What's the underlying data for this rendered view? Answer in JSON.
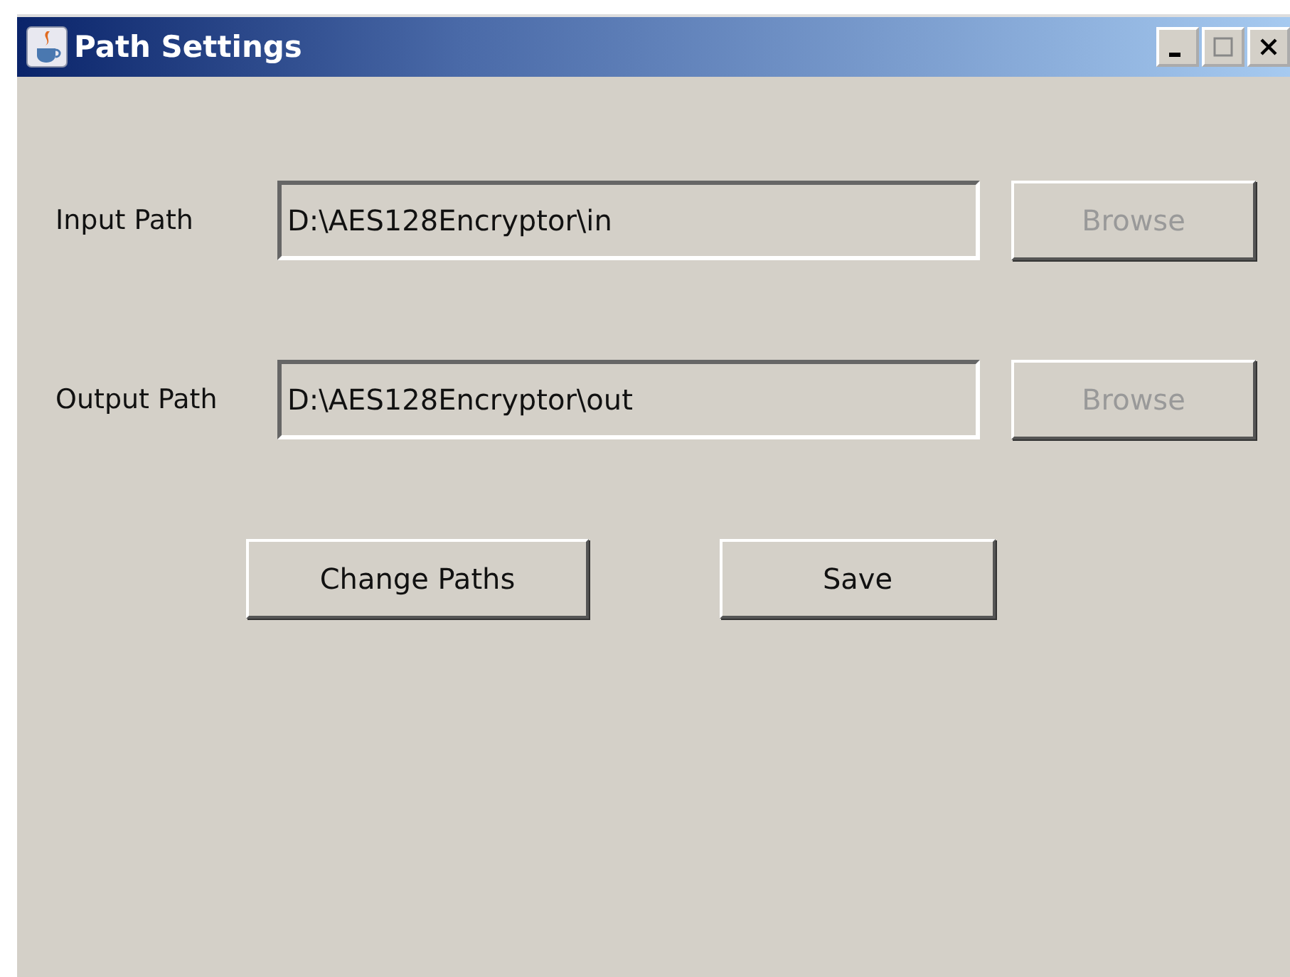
{
  "window": {
    "title": "Path Settings"
  },
  "rows": [
    {
      "label": "Input Path",
      "value": "D:\\AES128Encryptor\\in",
      "disabled": true,
      "button": {
        "label": "Browse",
        "disabled": true
      }
    },
    {
      "label": "Output Path",
      "value": "D:\\AES128Encryptor\\out",
      "disabled": true,
      "button": {
        "label": "Browse",
        "disabled": true
      }
    }
  ],
  "buttons": [
    {
      "label": "Change Paths",
      "disabled": false
    },
    {
      "label": "Save",
      "disabled": false
    }
  ]
}
